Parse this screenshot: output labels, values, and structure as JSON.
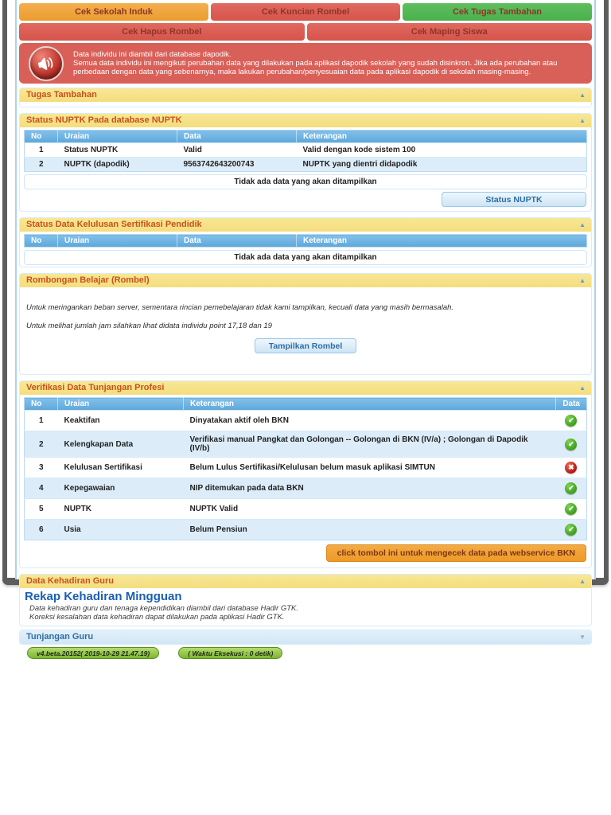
{
  "tabs": {
    "row1": [
      {
        "label": "Cek Sekolah Induk"
      },
      {
        "label": "Cek Kuncian Rombel"
      },
      {
        "label": "Cek Tugas Tambahan"
      }
    ],
    "row2": [
      {
        "label": "Cek Hapus Rombel"
      },
      {
        "label": "Cek Maping Siswa"
      }
    ]
  },
  "warning": {
    "line1": "Data individu ini diambil dari database dapodik.",
    "line2": "Semua data individu ini mengikuti perubahan data yang dilakukan pada aplikasi dapodik sekolah yang sudah disinkron. Jika ada perubahan atau perbedaan dengan data yang sebenarnya, maka lakukan perubahan/penyesuaian data pada aplikasi dapodik di sekolah masing-masing."
  },
  "sections": {
    "tugas_tambahan": {
      "title": "Tugas Tambahan"
    },
    "status_nuptk": {
      "title": "Status NUPTK Pada database NUPTK",
      "headers": [
        "No",
        "Uraian",
        "Data",
        "Keterangan"
      ],
      "rows": [
        {
          "no": "1",
          "uraian": "Status NUPTK",
          "data": "Valid",
          "keterangan": "Valid dengan kode sistem 100"
        },
        {
          "no": "2",
          "uraian": "NUPTK (dapodik)",
          "data": "9563742643200743",
          "keterangan": "NUPTK yang dientri didapodik"
        }
      ],
      "empty_text": "Tidak ada data yang akan ditampilkan",
      "button": "Status NUPTK"
    },
    "sertifikasi": {
      "title": "Status Data Kelulusan Sertifikasi Pendidik",
      "headers": [
        "No",
        "Uraian",
        "Data",
        "Keterangan"
      ],
      "empty_text": "Tidak ada data yang akan ditampilkan"
    },
    "rombel": {
      "title": "Rombongan Belajar (Rombel)",
      "note1": "Untuk meringankan beban server, sementara rincian pemebelajaran tidak kami tampilkan, kecuali data yang masih bermasalah.",
      "note2": "Untuk melihat jumlah jam silahkan lihat didata individu point 17,18 dan 19",
      "button": "Tampilkan Rombel"
    },
    "verifikasi": {
      "title": "Verifikasi Data Tunjangan Profesi",
      "headers": [
        "No",
        "Uraian",
        "Keterangan",
        "Data"
      ],
      "rows": [
        {
          "no": "1",
          "uraian": "Keaktifan",
          "keterangan": "Dinyatakan aktif oleh BKN",
          "status": "ok"
        },
        {
          "no": "2",
          "uraian": "Kelengkapan Data",
          "keterangan": "Verifikasi manual Pangkat dan Golongan -- Golongan di BKN (IV/a) ; Golongan di Dapodik (IV/b)",
          "status": "ok"
        },
        {
          "no": "3",
          "uraian": "Kelulusan Sertifikasi",
          "keterangan": "Belum Lulus Sertifikasi/Kelulusan belum masuk aplikasi SIMTUN",
          "status": "error"
        },
        {
          "no": "4",
          "uraian": "Kepegawaian",
          "keterangan": "NIP ditemukan pada data BKN",
          "status": "ok"
        },
        {
          "no": "5",
          "uraian": "NUPTK",
          "keterangan": "NUPTK Valid",
          "status": "ok"
        },
        {
          "no": "6",
          "uraian": "Usia",
          "keterangan": "Belum Pensiun",
          "status": "ok"
        }
      ],
      "button": "click tombol ini untuk mengecek data pada webservice BKN"
    },
    "kehadiran": {
      "title": "Data Kehadiran Guru",
      "heading": "Rekap Kehadiran Mingguan",
      "note1": "Data kehadiran guru dan tenaga kependidikan diambil dari database Hadir GTK.",
      "note2": "Koreksi kesalahan data kehadiran dapat dilakukan pada aplikasi Hadir GTK."
    },
    "tunjangan": {
      "title": "Tunjangan Guru"
    }
  },
  "footer": {
    "version_badge": "v4.beta.20152( 2019-10-29 21.47.19)",
    "exec_badge": "( Waktu Eksekusi : 0 detik)"
  },
  "ui": {
    "collapse_arrow_up": "▲",
    "collapse_arrow_down": "▼"
  },
  "colors": {
    "section_bar_bg": "#f5e185",
    "section_title": "#c8511c",
    "table_header_blue": "#6cb0de",
    "alt_row": "#dcedf9",
    "warning_bg": "#d96058",
    "btn_orange": "#efa236",
    "btn_red": "#d9584f",
    "btn_green": "#53b553",
    "badge_green": "#8cc045"
  }
}
